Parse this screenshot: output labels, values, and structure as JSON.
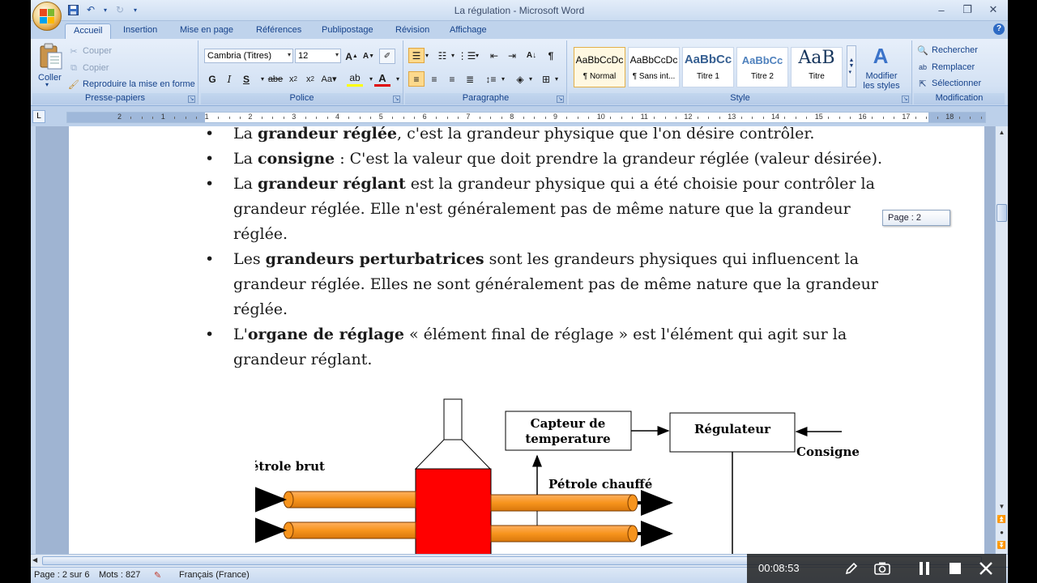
{
  "window": {
    "title": "La régulation - Microsoft Word"
  },
  "tabs": [
    "Accueil",
    "Insertion",
    "Mise en page",
    "Références",
    "Publipostage",
    "Révision",
    "Affichage"
  ],
  "active_tab": "Accueil",
  "ribbon": {
    "clipboard": {
      "paste": "Coller",
      "cut": "Couper",
      "copy": "Copier",
      "format_painter": "Reproduire la mise en forme",
      "label": "Presse-papiers"
    },
    "font": {
      "family": "Cambria (Titres)",
      "size": "12",
      "label": "Police"
    },
    "paragraph": {
      "label": "Paragraphe"
    },
    "styles": {
      "items": [
        {
          "preview": "AaBbCcDc",
          "name": "¶ Normal"
        },
        {
          "preview": "AaBbCcDc",
          "name": "¶ Sans int..."
        },
        {
          "preview": "AaBbCc",
          "name": "Titre 1"
        },
        {
          "preview": "AaBbCc",
          "name": "Titre 2"
        },
        {
          "preview": "AaB",
          "name": "Titre"
        }
      ],
      "modify": "Modifier les styles",
      "label": "Style"
    },
    "editing": {
      "find": "Rechercher",
      "replace": "Remplacer",
      "select": "Sélectionner",
      "label": "Modification"
    }
  },
  "ruler_numbers": [
    "2",
    "1",
    "1",
    "2",
    "3",
    "4",
    "5",
    "6",
    "7",
    "8",
    "9",
    "10",
    "11",
    "12",
    "13",
    "14",
    "15",
    "16",
    "17",
    "18"
  ],
  "document": {
    "bullets": [
      {
        "pre": "La ",
        "bold": "grandeur réglée",
        "post": ", c'est la grandeur physique que l'on désire contrôler."
      },
      {
        "pre": "La ",
        "bold": "consigne",
        "post": " : C'est la valeur que doit prendre la grandeur réglée (valeur désirée)."
      },
      {
        "pre": "La ",
        "bold": "grandeur réglant",
        "post": " est la grandeur physique qui a été choisie pour contrôler la grandeur réglée. Elle n'est généralement pas de même nature que la grandeur réglée."
      },
      {
        "pre": "Les ",
        "bold": "grandeurs perturbatrices",
        "post": " sont les grandeurs physiques qui influencent la grandeur réglée. Elles ne sont généralement pas de même nature que la grandeur réglée."
      },
      {
        "pre": "L'",
        "bold": "organe de réglage",
        "post": " « élément final de réglage » est l'élément qui agit sur la grandeur réglant."
      }
    ],
    "diagram": {
      "sensor": "Capteur de temperature",
      "sensor_line1": "Capteur de",
      "sensor_line2": "temperature",
      "regulator": "Régulateur",
      "setpoint": "Consigne",
      "crude": "Pétrole brut",
      "heated": "Pétrole chauffé"
    }
  },
  "page_tip": "Page : 2",
  "status": {
    "page": "Page : 2 sur 6",
    "words": "Mots : 827",
    "language": "Français (France)"
  },
  "overlay": {
    "time": "00:08:53"
  },
  "colors": {
    "furnace": "#ff0000",
    "pipe": "#f7941d",
    "ribbon": "#dbe6f5"
  }
}
